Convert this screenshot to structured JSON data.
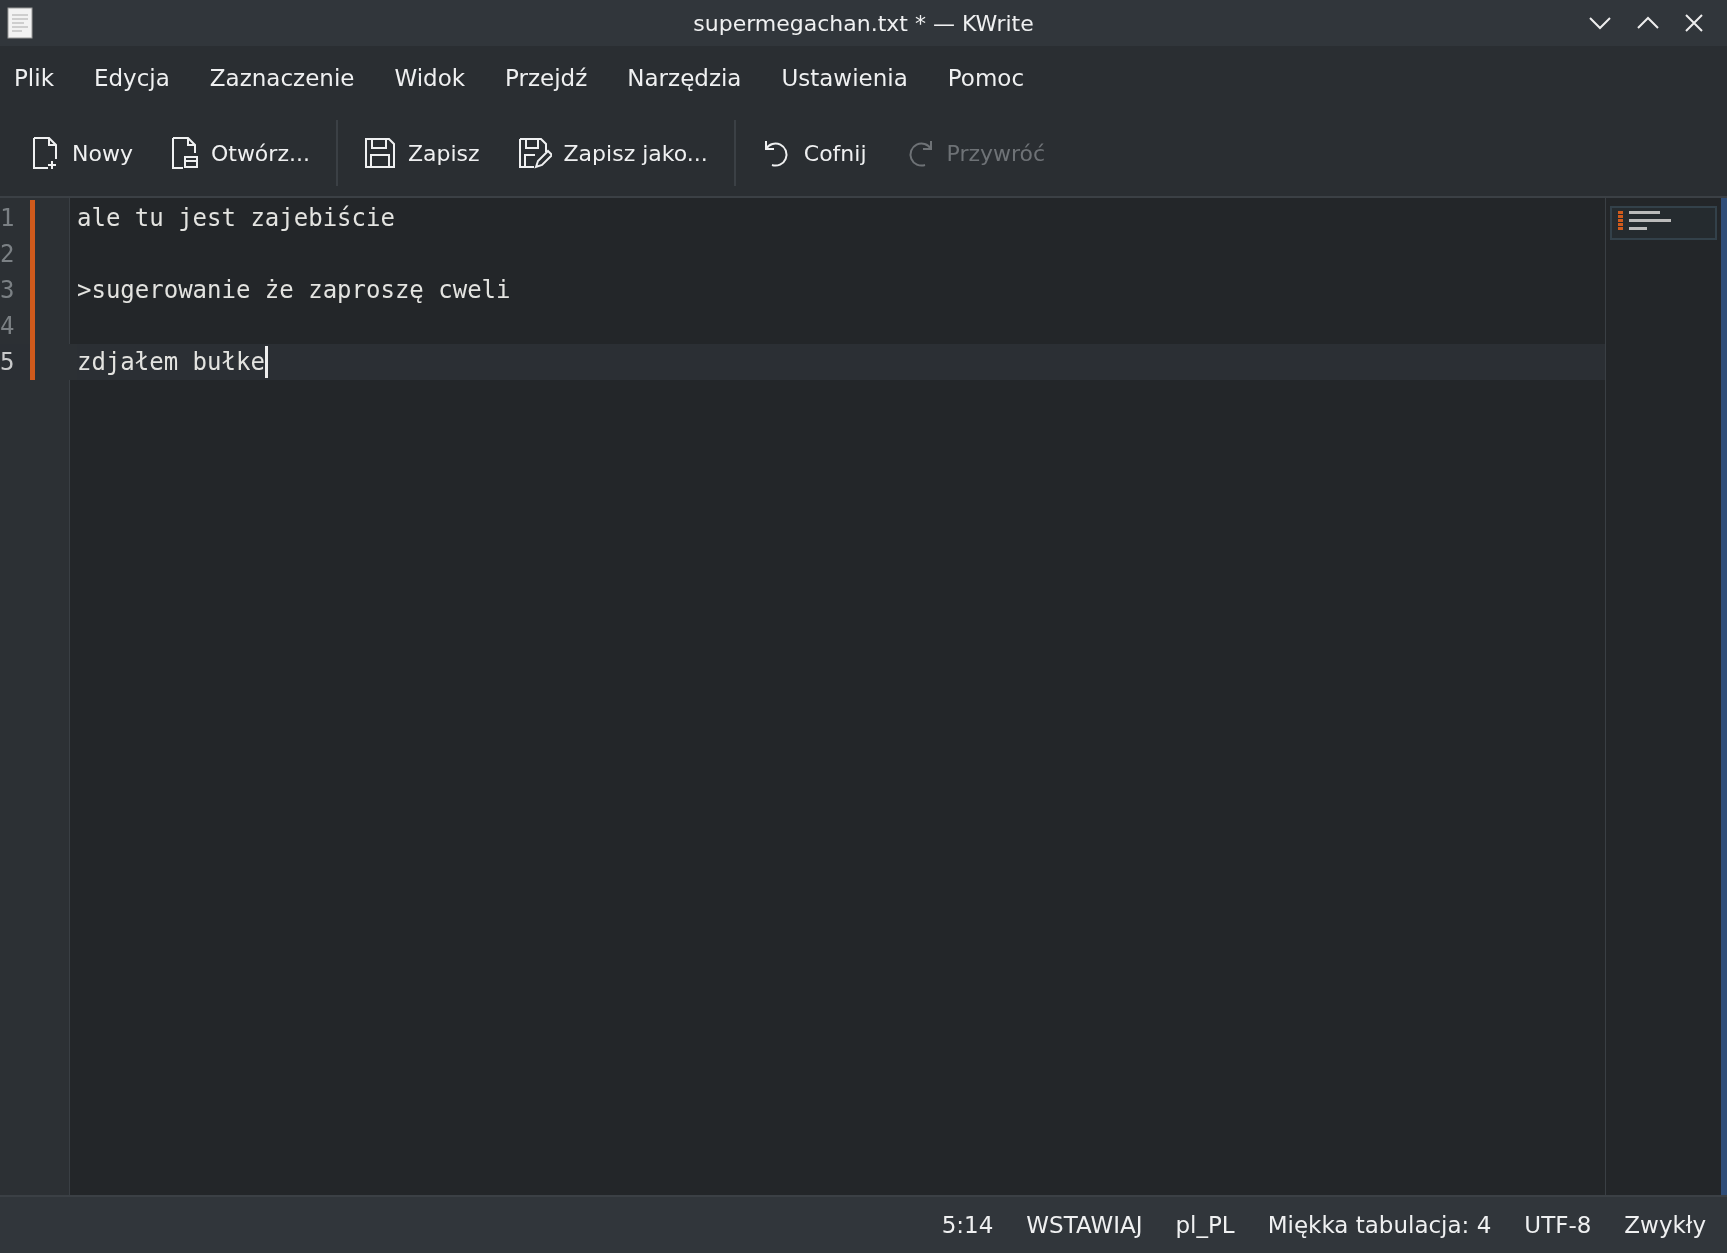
{
  "window": {
    "title": "supermegachan.txt * — KWrite"
  },
  "menu": [
    "Plik",
    "Edycja",
    "Zaznaczenie",
    "Widok",
    "Przejdź",
    "Narzędzia",
    "Ustawienia",
    "Pomoc"
  ],
  "toolbar": [
    {
      "kind": "new",
      "label": "Nowy",
      "disabled": false
    },
    {
      "kind": "open",
      "label": "Otwórz...",
      "disabled": false
    },
    {
      "kind": "separator"
    },
    {
      "kind": "save",
      "label": "Zapisz",
      "disabled": false
    },
    {
      "kind": "saveas",
      "label": "Zapisz jako...",
      "disabled": false
    },
    {
      "kind": "separator"
    },
    {
      "kind": "undo",
      "label": "Cofnij",
      "disabled": false
    },
    {
      "kind": "redo",
      "label": "Przywróć",
      "disabled": true
    }
  ],
  "editor": {
    "lines": [
      {
        "number": "1",
        "text": "ale tu jest zajebiście",
        "modified": true,
        "current": false
      },
      {
        "number": "2",
        "modified": true,
        "current": false
      },
      {
        "number": "3",
        "text": ">sugerowanie że zaproszę cweli",
        "modified": true,
        "current": false
      },
      {
        "number": "4",
        "modified": true,
        "current": false
      },
      {
        "number": "5",
        "text": "zdjałem bułke",
        "modified": true,
        "current": true
      }
    ]
  },
  "status_bar": [
    "5:14",
    "WSTAWIAJ",
    "pl_PL",
    "Miękka tabulacja: 4",
    "UTF-8",
    "Zwykły"
  ]
}
